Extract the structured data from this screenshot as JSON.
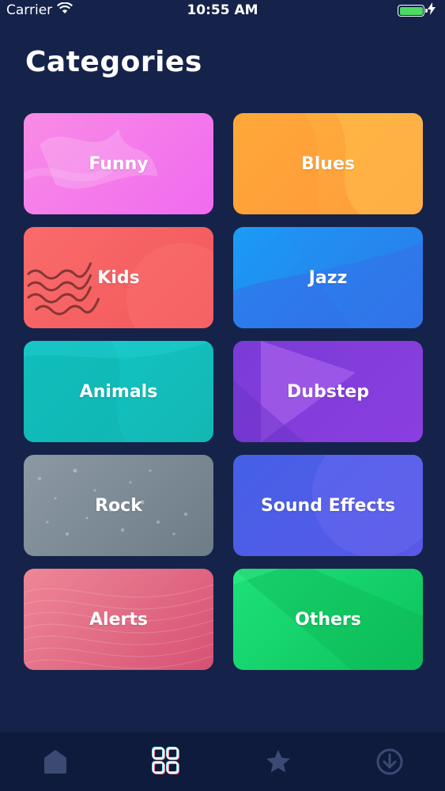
{
  "status_bar": {
    "carrier": "Carrier",
    "time": "10:55 AM"
  },
  "page": {
    "title": "Categories"
  },
  "categories": [
    {
      "label": "Funny"
    },
    {
      "label": "Blues"
    },
    {
      "label": "Kids"
    },
    {
      "label": "Jazz"
    },
    {
      "label": "Animals"
    },
    {
      "label": "Dubstep"
    },
    {
      "label": "Rock"
    },
    {
      "label": "Sound Effects"
    },
    {
      "label": "Alerts"
    },
    {
      "label": "Others"
    }
  ],
  "tab_bar": {
    "tabs": [
      {
        "icon": "home-icon",
        "active": false
      },
      {
        "icon": "categories-icon",
        "active": true
      },
      {
        "icon": "star-icon",
        "active": false
      },
      {
        "icon": "download-icon",
        "active": false
      }
    ]
  },
  "colors": {
    "background": "#15234a",
    "tab_bar": "#0f1b3c",
    "inactive_icon": "#3a4a73"
  }
}
